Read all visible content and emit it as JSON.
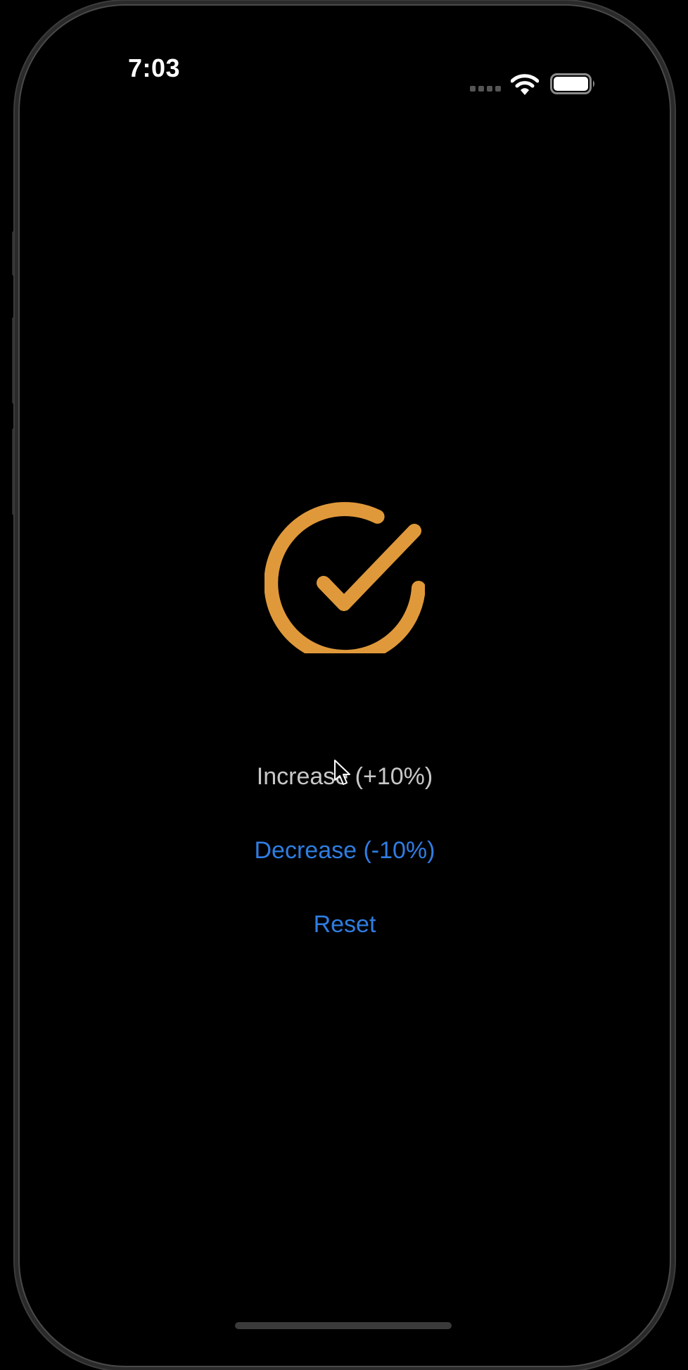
{
  "status_bar": {
    "time": "7:03",
    "signal_icon": "cellular-dots-icon",
    "wifi_icon": "wifi-icon",
    "battery_icon": "battery-icon"
  },
  "main": {
    "icon": "checkmark-circle-icon",
    "icon_color": "#E0993A",
    "buttons": [
      {
        "label": "Increase (+10%)",
        "color": "#C8C8C8",
        "state": "pressed"
      },
      {
        "label": "Decrease (-10%)",
        "color": "#2F7DE1"
      },
      {
        "label": "Reset",
        "color": "#2F7DE1"
      }
    ]
  },
  "colors": {
    "background": "#000000",
    "accent": "#2F7DE1"
  }
}
